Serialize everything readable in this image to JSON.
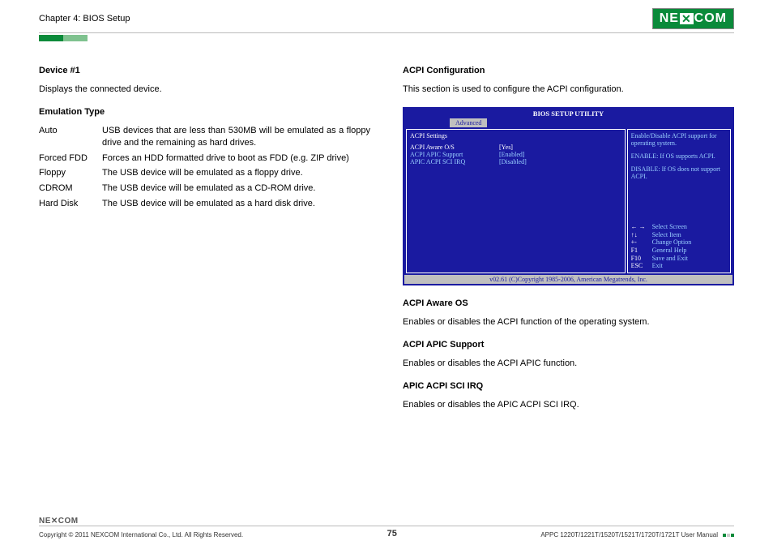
{
  "header": {
    "chapter": "Chapter 4: BIOS Setup",
    "logo_pre": "NE",
    "logo_x": "✕",
    "logo_post": "COM"
  },
  "left": {
    "h1": "Device #1",
    "p1": "Displays the connected device.",
    "h2": "Emulation Type",
    "rows": [
      {
        "k": "Auto",
        "v": "USB devices that are less than 530MB will be emulated as a floppy drive and the remaining as hard drives."
      },
      {
        "k": "Forced FDD",
        "v": "Forces an HDD formatted drive to boot as FDD (e.g. ZIP drive)"
      },
      {
        "k": "Floppy",
        "v": "The USB device will be emulated as a floppy drive."
      },
      {
        "k": "CDROM",
        "v": "The USB device will be emulated as a CD-ROM drive."
      },
      {
        "k": "Hard Disk",
        "v": "The USB device will be emulated as a hard disk drive."
      }
    ]
  },
  "right": {
    "h1": "ACPI Configuration",
    "p1": "This section is used to configure the ACPI configuration.",
    "h2": "ACPI Aware OS",
    "p2": "Enables or disables the ACPI function of the operating system.",
    "h3": "ACPI APIC Support",
    "p3": "Enables or disables the ACPI APIC function.",
    "h4": "APIC ACPI SCI IRQ",
    "p4": "Enables or disables the APIC ACPI SCI IRQ."
  },
  "bios": {
    "title": "BIOS SETUP UTILITY",
    "tab": "Advanced",
    "section": "ACPI Settings",
    "opts": [
      {
        "k": "ACPI Aware O/S",
        "v": "[Yes]",
        "sel": true
      },
      {
        "k": "ACPI APIC Support",
        "v": "[Enabled]",
        "sel": false
      },
      {
        "k": "APIC ACPI SCI IRQ",
        "v": "[Disabled]",
        "sel": false
      }
    ],
    "help1": "Enable/Disable ACPI support for operating system.",
    "help2": "ENABLE: If OS supports ACPI.",
    "help3": "DISABLE: If OS does not support ACPI.",
    "nav": [
      {
        "k": "← →",
        "v": "Select Screen"
      },
      {
        "k": "↑↓",
        "v": "Select Item"
      },
      {
        "k": "+-",
        "v": "Change Option"
      },
      {
        "k": "F1",
        "v": "General Help"
      },
      {
        "k": "F10",
        "v": "Save and Exit"
      },
      {
        "k": "ESC",
        "v": "Exit"
      }
    ],
    "foot": "v02.61 (C)Copyright 1985-2006, American Megatrends, Inc."
  },
  "footer": {
    "logo": "NE✕COM",
    "copy": "Copyright © 2011 NEXCOM International Co., Ltd. All Rights Reserved.",
    "page": "75",
    "doc": "APPC 1220T/1221T/1520T/1521T/1720T/1721T User Manual"
  }
}
